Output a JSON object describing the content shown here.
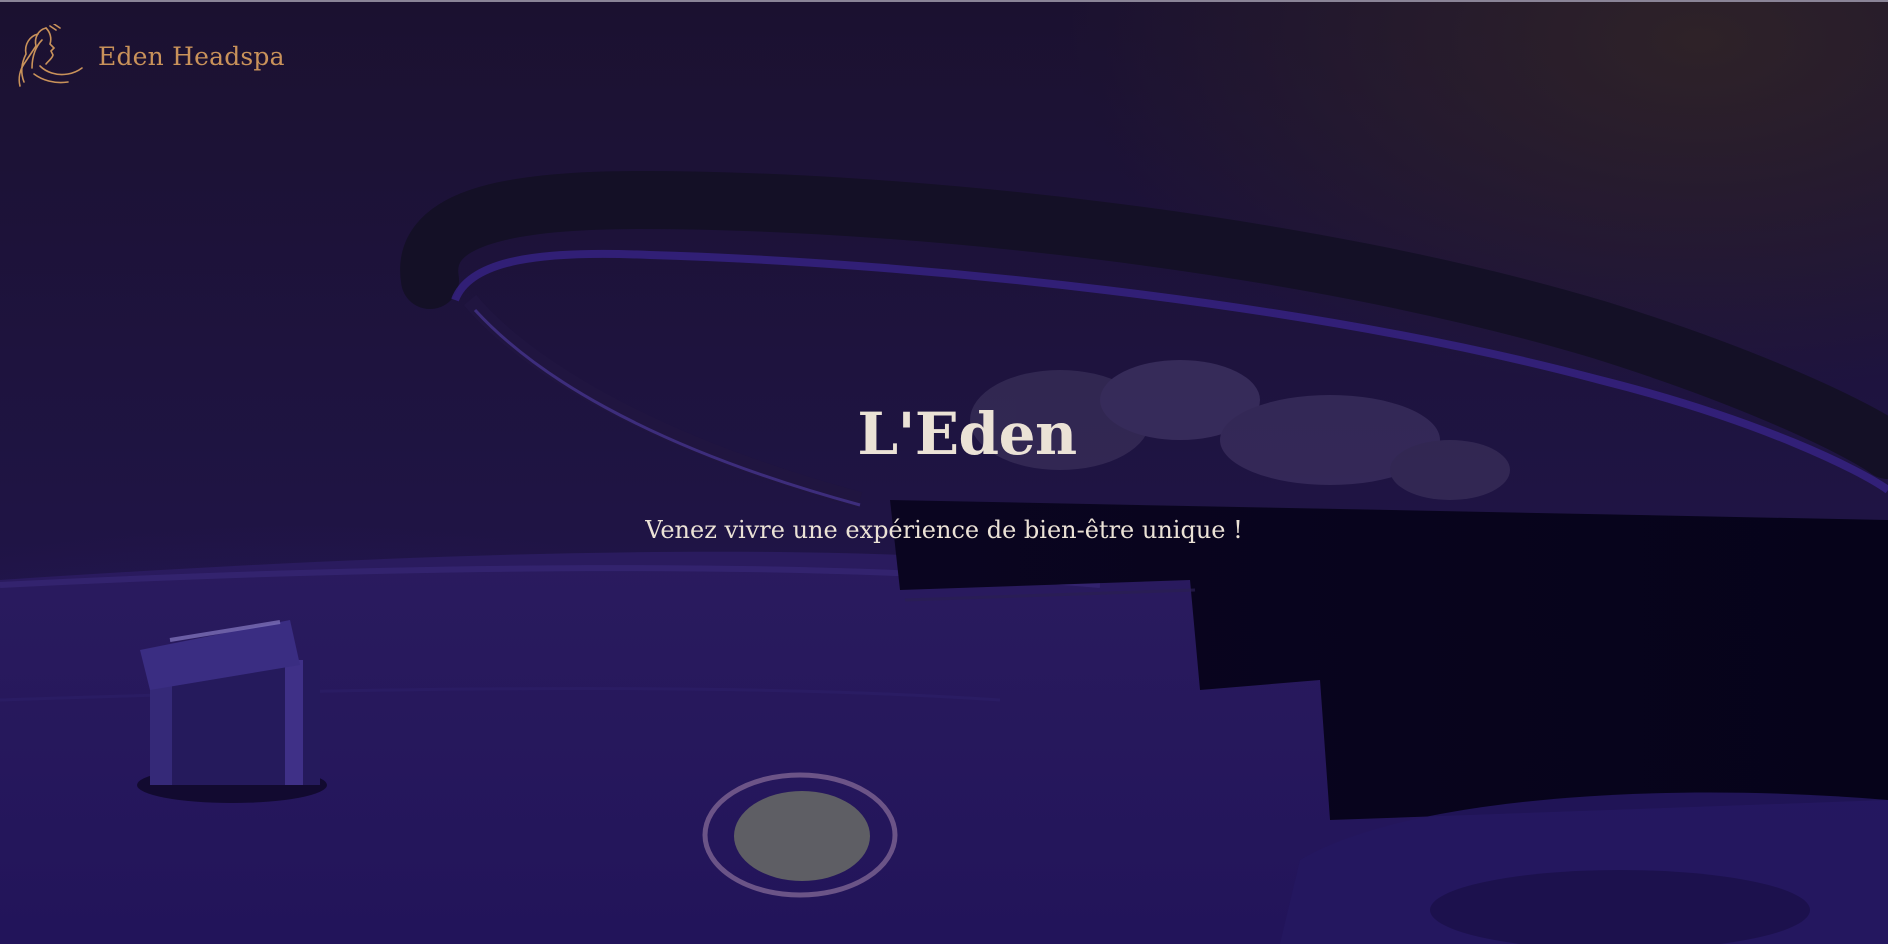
{
  "navbar": {
    "brand_name": "Eden Headspa",
    "logo_icon": "woman-profile-logo-icon",
    "accent_color": "#c9925a"
  },
  "hero": {
    "title": "L'Eden",
    "subtitle": "Venez vivre une expérience de bien-être unique !",
    "text_color": "#ebe2d6"
  }
}
